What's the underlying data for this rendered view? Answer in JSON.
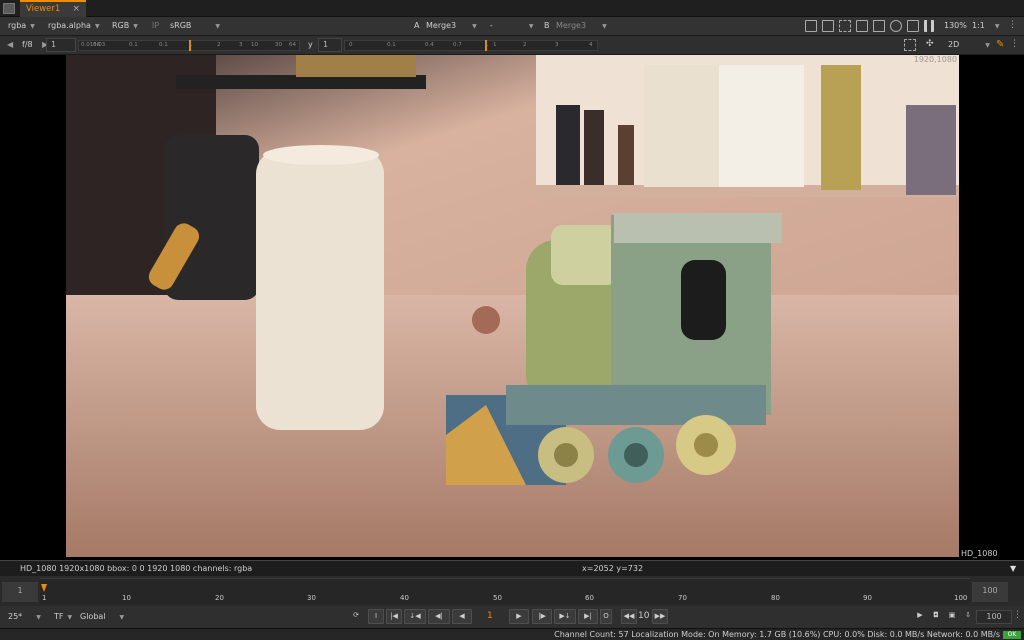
{
  "tab": {
    "title": "Viewer1",
    "close": "×"
  },
  "toolbar1": {
    "channels": "rgba",
    "alpha": "rgba.alpha",
    "color": "RGB",
    "ip": "IP",
    "lut": "sRGB",
    "input_a_label": "A",
    "input_a": "Merge3",
    "mix": "-",
    "input_b_label": "B",
    "input_b": "Merge3",
    "zoom": "130%",
    "ratio": "1:1"
  },
  "toolbar2": {
    "fstop": "f/8",
    "frame": "1",
    "gain_ticks": [
      "0.0156",
      "0.03",
      "0.1",
      "0.1",
      "1",
      "2",
      "3",
      "10",
      "30",
      "64"
    ],
    "gamma_label": "y",
    "gamma": "1",
    "gamma_ticks": [
      "0",
      "0.1",
      "0.4",
      "0.7",
      "1",
      "1",
      "2",
      "3",
      "4"
    ],
    "view_mode": "2D"
  },
  "viewer": {
    "res_top": "1920,1080",
    "res_bottom": "HD_1080"
  },
  "info": {
    "format": "HD_1080 1920x1080  bbox: 0 0 1920 1080 channels: rgba",
    "coords": "x=2052 y=732"
  },
  "timeline": {
    "start": "1",
    "end": "100",
    "labels": [
      "1",
      "10",
      "20",
      "30",
      "40",
      "50",
      "60",
      "70",
      "80",
      "90",
      "100"
    ]
  },
  "controls": {
    "fps": "25*",
    "tf": "TF",
    "scope": "Global",
    "current_frame": "1",
    "step": "10",
    "end_frame": "100"
  },
  "status": {
    "text": "Channel Count: 57  Localization Mode: On  Memory: 1.7 GB (10.6%)  CPU: 0.0%  Disk: 0.0 MB/s  Network: 0.0 MB/s",
    "ok": "OK"
  },
  "colors": {
    "accent": "#f28c00",
    "bg": "#2b2b2b",
    "ok": "#3aa33a"
  }
}
